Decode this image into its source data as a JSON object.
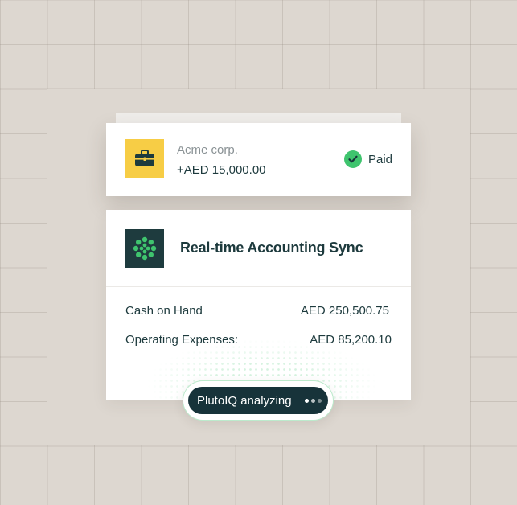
{
  "payment": {
    "company": "Acme corp.",
    "amount": "+AED 15,000.00",
    "status": "Paid",
    "company_icon": "briefcase-icon",
    "status_icon": "check-circle-icon",
    "icon_bg": "#f7cd45",
    "status_color": "#3fc46e"
  },
  "sync": {
    "title": "Real-time Accounting Sync",
    "logo_icon": "plutoiq-logo-icon",
    "rows": [
      {
        "label": "Cash on Hand",
        "value": "AED 250,500.75"
      },
      {
        "label": "Operating Expenses:",
        "value": "AED 85,200.10"
      }
    ]
  },
  "status_pill": {
    "label": "PlutoIQ analyzing",
    "indicator_icon": "typing-dots-icon"
  },
  "colors": {
    "background": "#ddd7d0",
    "dark": "#1d3a3d",
    "accent": "#3fc46e"
  }
}
